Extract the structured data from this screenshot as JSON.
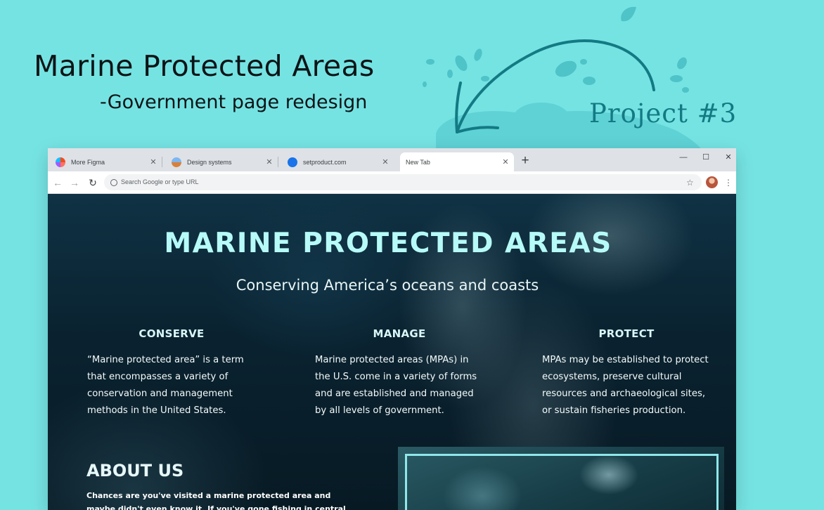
{
  "presentation": {
    "title": "Marine Protected Areas",
    "subtitle": "-Government page redesign",
    "project_label": "Project #3",
    "accent_color": "#137a84",
    "background_color": "#76e3e3"
  },
  "browser": {
    "tabs": [
      {
        "label": "More Figma",
        "icon": "figma-logo-icon"
      },
      {
        "label": "Design systems",
        "icon": "design-systems-favicon"
      },
      {
        "label": "setproduct.com",
        "icon": "setproduct-favicon"
      },
      {
        "label": "New Tab",
        "icon": null,
        "active": true
      }
    ],
    "new_tab_label": "+",
    "window_controls": {
      "minimize": "—",
      "maximize": "☐",
      "close": "✕"
    },
    "omnibox_placeholder": "Search Google or type URL"
  },
  "page": {
    "title": "MARINE PROTECTED AREAS",
    "subtitle": "Conserving America’s oceans and coasts",
    "columns": [
      {
        "heading": "CONSERVE",
        "text": "“Marine protected area” is a term that encompasses a variety of conservation and management methods in the United States."
      },
      {
        "heading": "MANAGE",
        "text": "Marine protected areas (MPAs) in the U.S. come in a variety of forms and are established and managed by all levels of government."
      },
      {
        "heading": "PROTECT",
        "text": "MPAs may be established to protect ecosystems, preserve cultural resources and archaeological sites, or sustain fisheries production."
      }
    ],
    "about": {
      "title": "ABOUT US",
      "text": "Chances are you've visited a marine protected area and maybe didn't even know it. If you've gone fishing in central California, diving in the"
    },
    "title_color": "#b6fbf8"
  }
}
